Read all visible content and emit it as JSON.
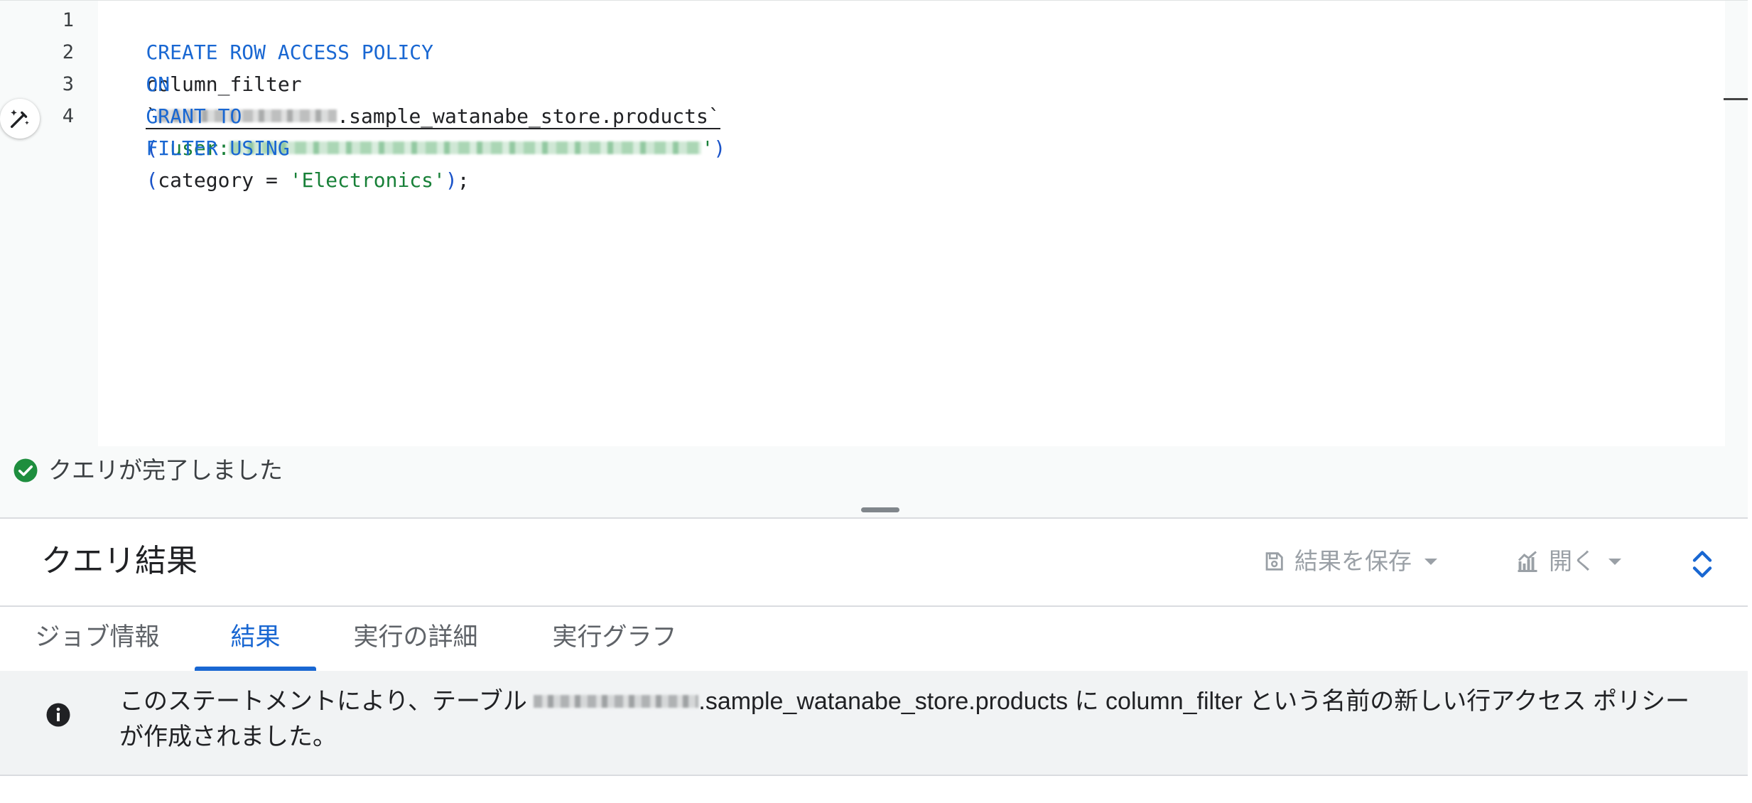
{
  "editor": {
    "line_numbers": [
      "1",
      "2",
      "3",
      "4"
    ],
    "lines": {
      "l1": {
        "kw1": "CREATE ROW ACCESS POLICY",
        "name": "column_filter"
      },
      "l2": {
        "kw": "ON",
        "tick_open": "`",
        "table": ".sample_watanabe_store.products",
        "tick_close": "`"
      },
      "l3": {
        "kw": "GRANT TO",
        "paren_open": "(",
        "str_open": "'user:",
        "str_close": "'",
        "paren_close": ")"
      },
      "l4": {
        "kw": "FILTER USING",
        "paren_open": "(",
        "expr": "category = ",
        "str": "'Electronics'",
        "paren_close": ")",
        "semi": ";"
      }
    }
  },
  "status": {
    "text": "クエリが完了しました",
    "color": "#1e8e3e"
  },
  "results": {
    "title": "クエリ結果",
    "save_label": "結果を保存",
    "open_label": "開く"
  },
  "tabs": [
    "ジョブ情報",
    "結果",
    "実行の詳細",
    "実行グラフ"
  ],
  "active_tab": "結果",
  "message": {
    "part1": "このステートメントにより、テーブル ",
    "part2": ".sample_watanabe_store.products に column_filter という名前の新しい行アクセス ポリシーが作成されました。"
  },
  "colors": {
    "accent": "#1967d2",
    "keyword": "#1967d2",
    "string": "#188038"
  },
  "icons": {
    "wand": "magic-wand-icon",
    "status": "check-circle-icon",
    "save": "save-icon",
    "open": "chart-icon",
    "expand": "expand-icon",
    "info": "info-icon"
  }
}
